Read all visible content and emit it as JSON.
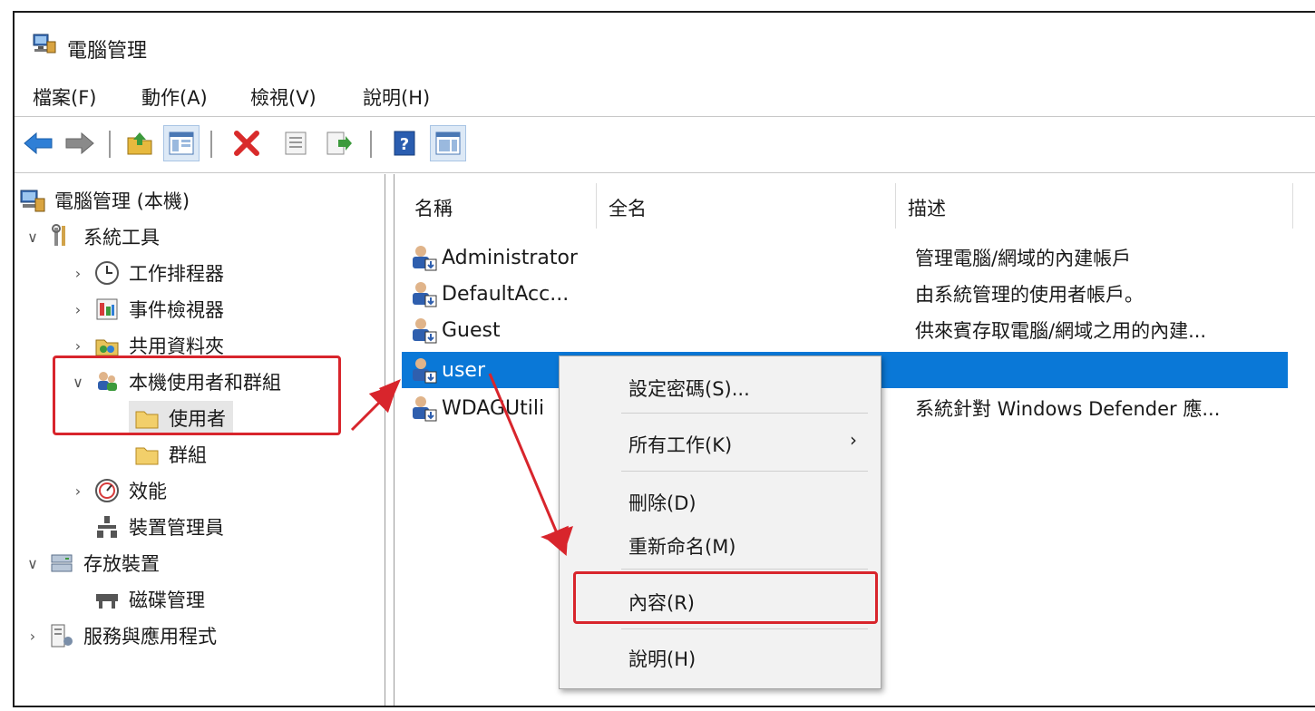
{
  "window": {
    "title": "電腦管理"
  },
  "menu": [
    "檔案(F)",
    "動作(A)",
    "檢視(V)",
    "說明(H)"
  ],
  "toolbar": [
    "back-icon",
    "forward-icon",
    "up-folder-icon",
    "show-hide-tree-icon",
    "delete-icon",
    "properties-icon",
    "export-list-icon",
    "help-icon",
    "show-hide-action-pane-icon"
  ],
  "tree": {
    "root": "電腦管理 (本機)",
    "system_tools": "系統工具",
    "task_scheduler": "工作排程器",
    "event_viewer": "事件檢視器",
    "shared_folders": "共用資料夾",
    "local_users_groups": "本機使用者和群組",
    "users": "使用者",
    "groups": "群組",
    "performance": "效能",
    "device_manager": "裝置管理員",
    "storage": "存放裝置",
    "disk_management": "磁碟管理",
    "services_apps": "服務與應用程式"
  },
  "list": {
    "headers": [
      "名稱",
      "全名",
      "描述"
    ],
    "rows": [
      {
        "name": "Administrator",
        "full_name": "",
        "description": "管理電腦/網域的內建帳戶"
      },
      {
        "name": "DefaultAcc...",
        "full_name": "",
        "description": "由系統管理的使用者帳戶。"
      },
      {
        "name": "Guest",
        "full_name": "",
        "description": "供來賓存取電腦/網域之用的內建..."
      },
      {
        "name": "user",
        "full_name": "",
        "description": ""
      },
      {
        "name": "WDAGUtili",
        "full_name": "",
        "description": "系統針對 Windows Defender 應..."
      }
    ]
  },
  "context_menu": {
    "set_password": "設定密碼(S)...",
    "all_tasks": "所有工作(K)",
    "submenu_arrow": "›",
    "delete": "刪除(D)",
    "rename": "重新命名(M)",
    "properties": "內容(R)",
    "help": "說明(H)"
  },
  "colors": {
    "selection": "#0a78d7",
    "highlight": "#d8252c",
    "menu_bg": "#f2f2f2"
  }
}
